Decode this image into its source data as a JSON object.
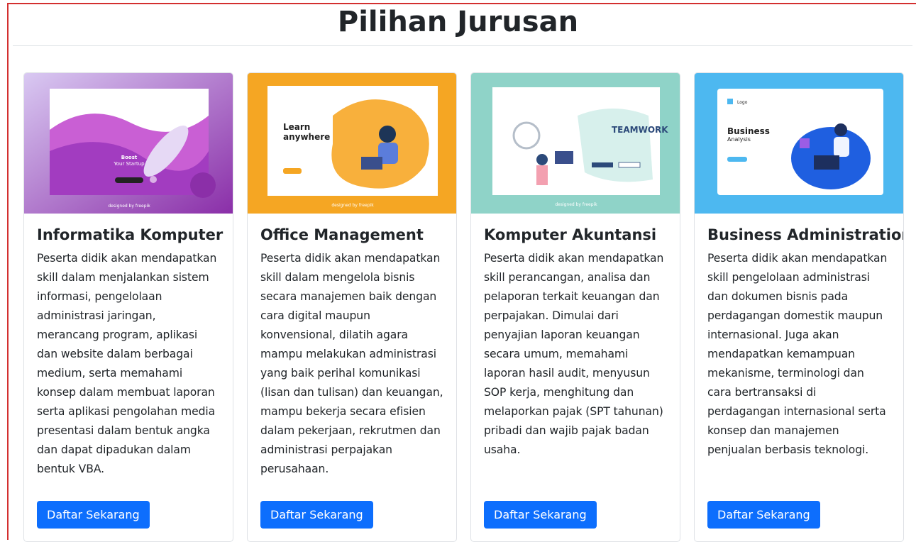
{
  "page": {
    "title": "Pilihan Jurusan"
  },
  "cards": [
    {
      "title": "Informatika Komputer",
      "text": "Peserta didik akan mendapatkan skill dalam menjalankan sistem informasi, pengelolaan administrasi jaringan, merancang program, aplikasi dan website dalam berbagai medium, serta memahami konsep dalam membuat laporan serta aplikasi pengolahan media presentasi dalam bentuk angka dan dapat dipadukan dalam bentuk VBA.",
      "button": "Daftar Sekarang",
      "image": {
        "bg": "#b247c4",
        "caption_main": "Boost Your Startup",
        "footer": "designed by freepik"
      }
    },
    {
      "title": "Office Management",
      "text": "Peserta didik akan mendapatkan skill dalam mengelola bisnis secara manajemen baik dengan cara digital maupun konvensional, dilatih agara mampu melakukan administrasi yang baik perihal komunikasi (lisan dan tulisan) dan keuangan, mampu bekerja secara efisien dalam pekerjaan, rekrutmen dan administrasi perpajakan perusahaan.",
      "button": "Daftar Sekarang",
      "image": {
        "bg": "#f5a623",
        "caption_main": "Learn anywhere",
        "footer": "designed by freepik"
      }
    },
    {
      "title": "Komputer Akuntansi",
      "text": "Peserta didik akan mendapatkan skill perancangan, analisa dan pelaporan terkait keuangan dan perpajakan. Dimulai dari penyajian laporan keuangan secara umum, memahami laporan hasil audit, menyusun SOP kerja, menghitung dan melaporkan pajak (SPT tahunan) pribadi dan wajib pajak badan usaha.",
      "button": "Daftar Sekarang",
      "image": {
        "bg": "#8fd3c8",
        "caption_main": "TEAMWORK",
        "footer": "designed by freepik"
      }
    },
    {
      "title": "Business Administration",
      "text": "Peserta didik akan mendapatkan skill pengelolaan administrasi dan dokumen bisnis pada perdagangan domestik maupun internasional. Juga akan mendapatkan kemampuan mekanisme, terminologi dan cara bertransaksi di perdagangan internasional serta konsep dan manajemen penjualan berbasis teknologi.",
      "button": "Daftar Sekarang",
      "image": {
        "bg": "#4db8f0",
        "caption_main": "Business",
        "caption_sub": "Analysis",
        "logo": "Logo"
      }
    }
  ]
}
